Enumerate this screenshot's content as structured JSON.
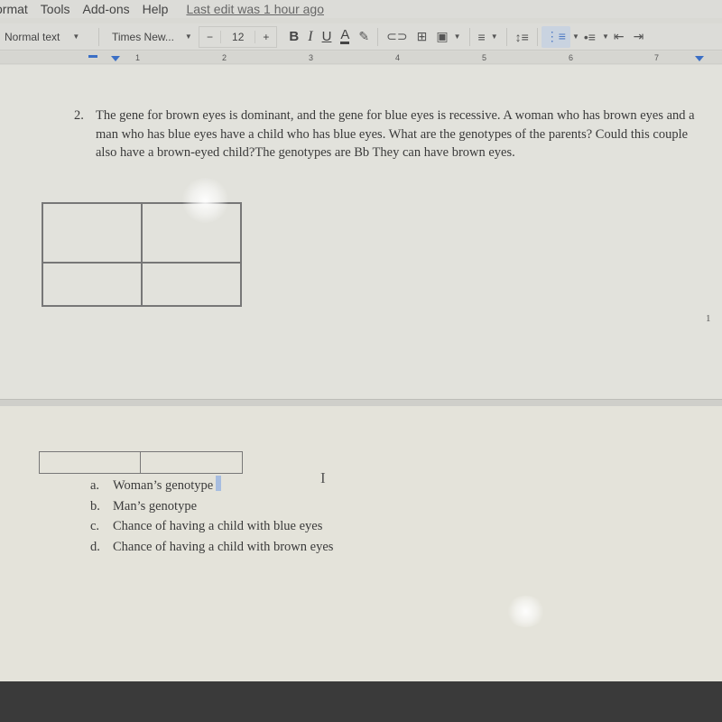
{
  "menubar": {
    "items": [
      "ormat",
      "Tools",
      "Add-ons",
      "Help"
    ],
    "last_edit": "Last edit was 1 hour ago"
  },
  "toolbar": {
    "style": "Normal text",
    "font": "Times New...",
    "font_size": "12",
    "minus": "−",
    "plus": "+",
    "bold": "B",
    "italic": "I",
    "underline": "U",
    "text_color": "A",
    "icons": {
      "highlight": "✎",
      "link": "⊂⊃",
      "comment": "⊞",
      "image": "▣",
      "align": "≡",
      "line_spacing": "↕≡",
      "numbered_list": "⋮≡",
      "bulleted_list": "•≡",
      "indent_decrease": "⇤",
      "indent_increase": "⇥"
    }
  },
  "ruler": {
    "ticks": [
      "1",
      "2",
      "3",
      "4",
      "5",
      "6",
      "7"
    ]
  },
  "document": {
    "question_number": "2.",
    "question_text": "The gene for brown eyes is dominant, and the gene for blue eyes is recessive.  A woman who has brown eyes and a man who has blue eyes have a child who has blue eyes.  What are the genotypes of the parents?  Could this couple also have a brown-eyed child?The genotypes are Bb They can have brown eyes.",
    "page_number": "1",
    "sublist": [
      {
        "letter": "a.",
        "text": "Woman’s genotype"
      },
      {
        "letter": "b.",
        "text": "Man’s genotype"
      },
      {
        "letter": "c.",
        "text": "Chance of having a child with blue eyes"
      },
      {
        "letter": "d.",
        "text": "Chance of having a child with brown eyes"
      }
    ],
    "ibeam": "I"
  },
  "colors": {
    "accent": "#3b6fc5",
    "selection": "#a7bde0"
  }
}
